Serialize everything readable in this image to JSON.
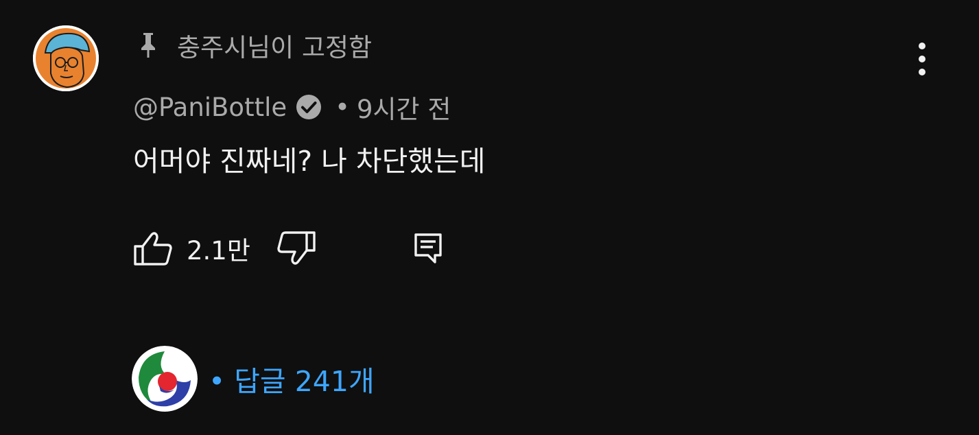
{
  "comment": {
    "avatar_alt": "PaniBottle avatar",
    "pinned_label": "충주시님이 고정함",
    "author": "@PaniBottle",
    "separator": "•",
    "timestamp": "9시간 전",
    "text": "어머야 진짜네? 나 차단했는데",
    "like_count": "2.1만",
    "replies_label": "• 답글 241개"
  },
  "colors": {
    "background": "#0f0f0f",
    "primary_text": "#f1f1f1",
    "secondary_text": "#aaaaaa",
    "link_blue": "#3ea6ff"
  },
  "icons": {
    "pin": "pin-icon",
    "verified": "verified-check-icon",
    "more": "more-vert-icon",
    "like": "thumb-up-icon",
    "dislike": "thumb-down-icon",
    "reply": "comment-reply-icon"
  }
}
